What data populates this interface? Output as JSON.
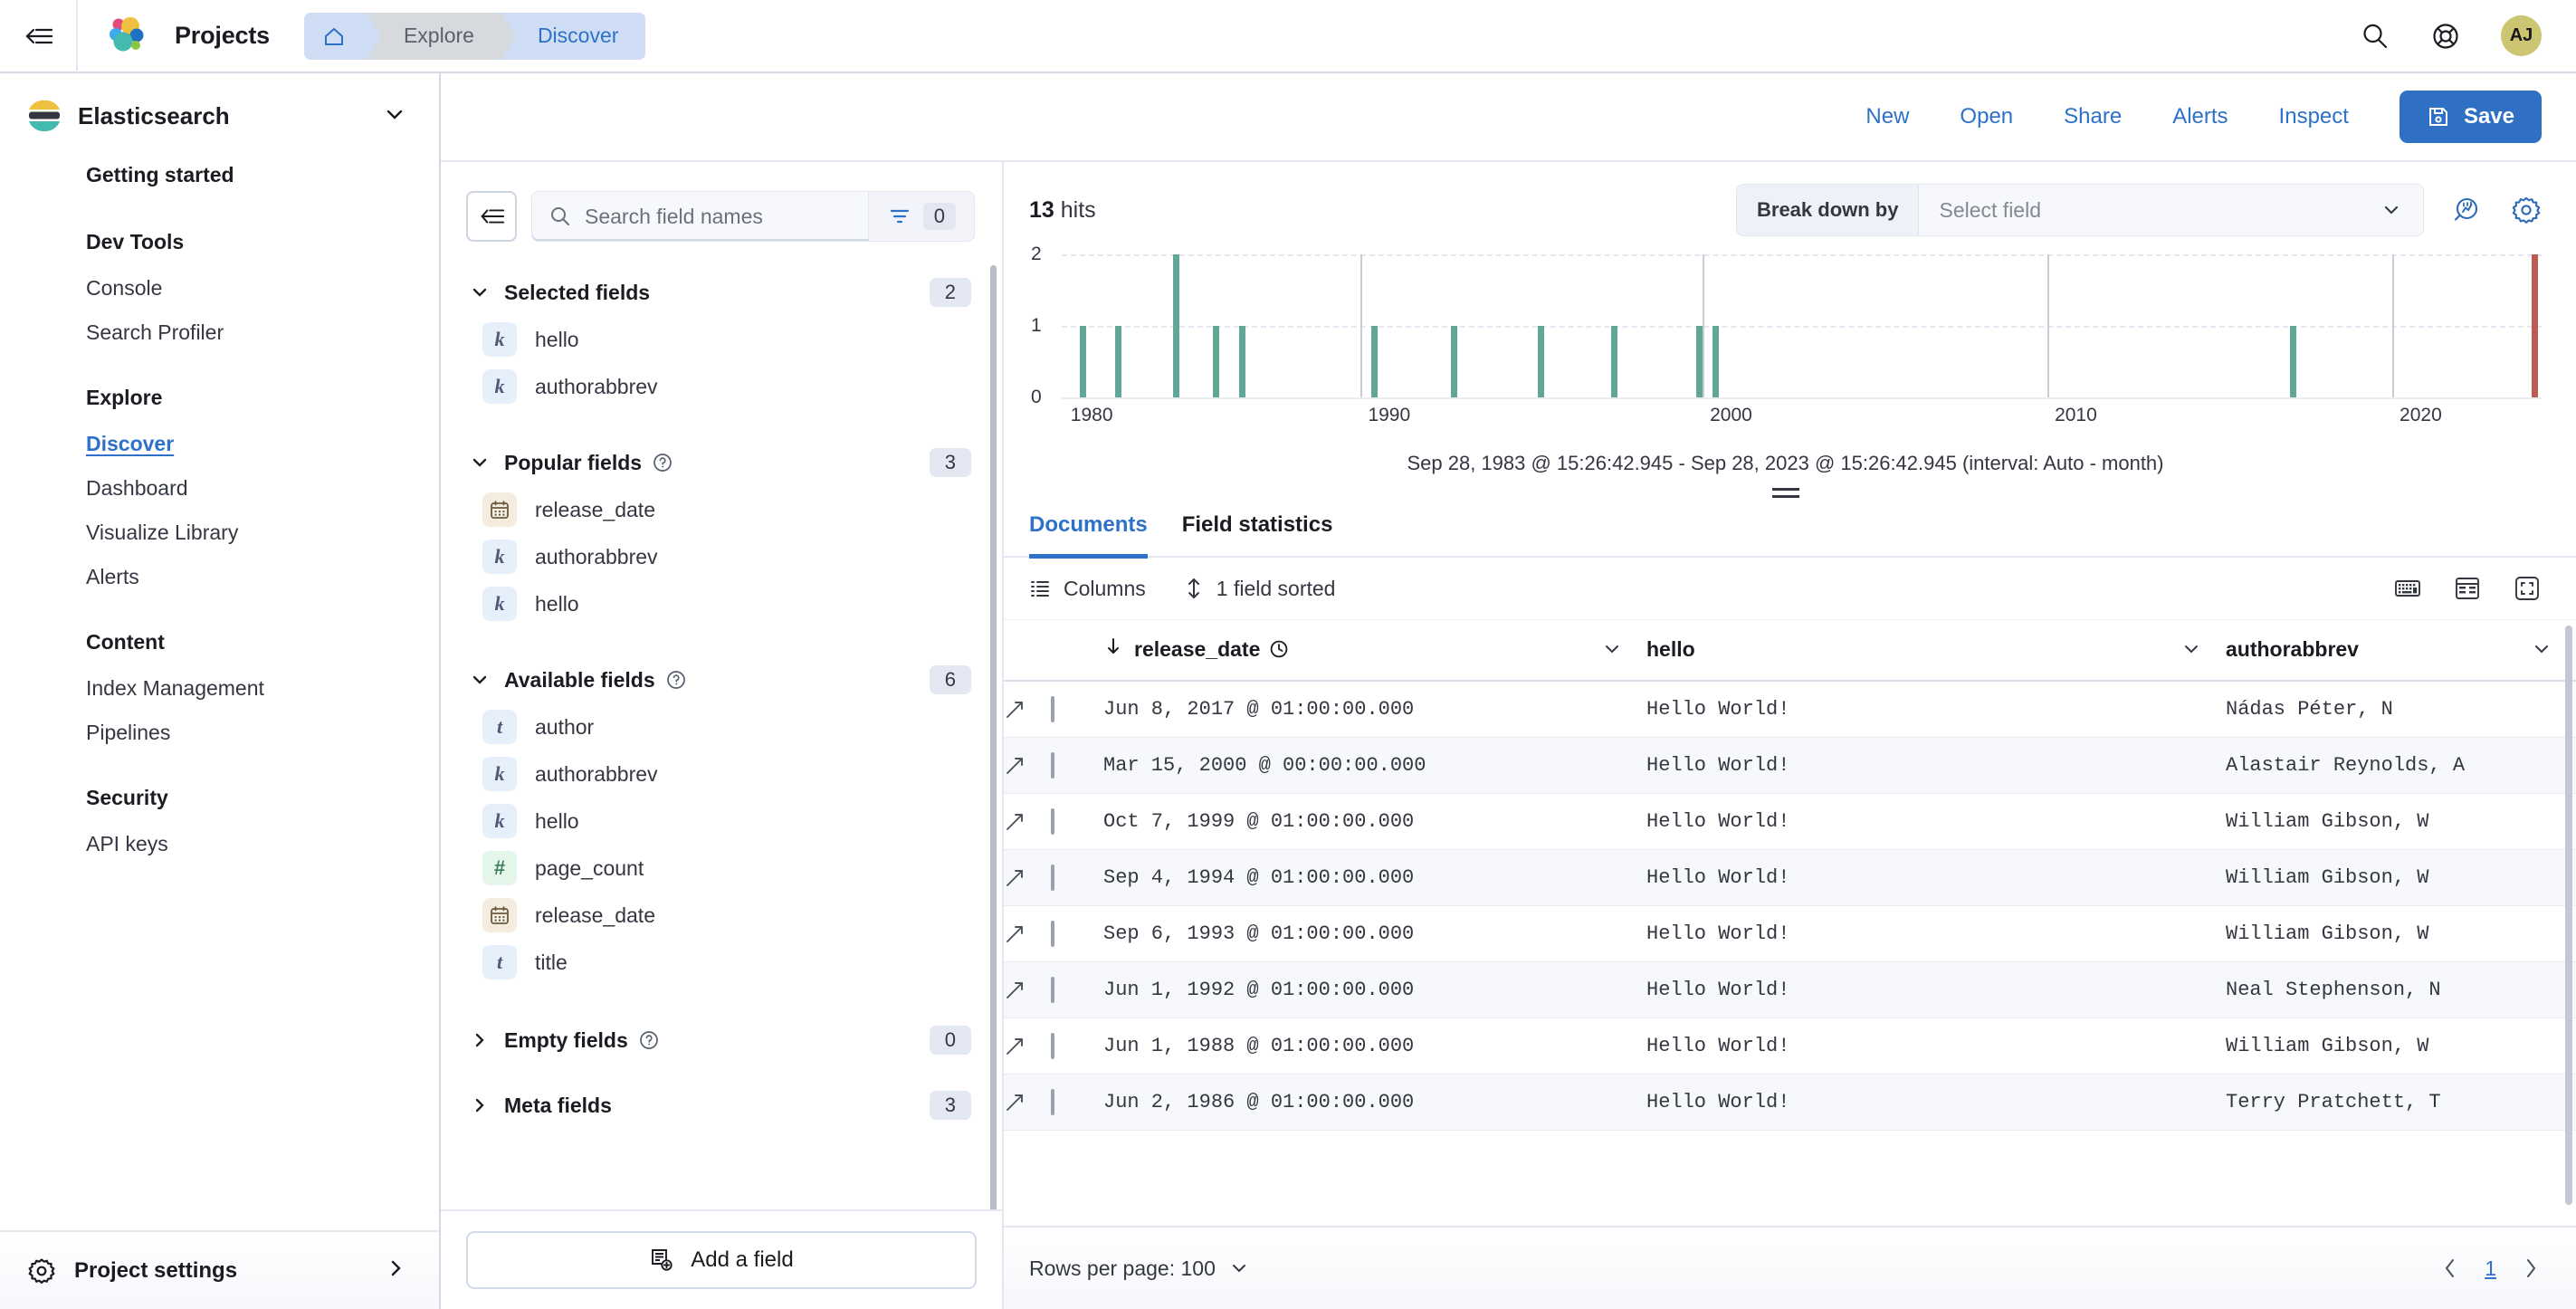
{
  "chrome": {
    "collapse_icon": "collapse-nav-icon",
    "logo": "elastic-logo-icon",
    "title": "Projects",
    "breadcrumbs": [
      {
        "label": "",
        "icon": "home-icon",
        "type": "home"
      },
      {
        "label": "Explore",
        "type": "mid"
      },
      {
        "label": "Discover",
        "type": "last"
      }
    ],
    "actions": [
      {
        "name": "search-icon",
        "label": ""
      },
      {
        "name": "help-icon",
        "label": ""
      }
    ],
    "avatar_initials": "AJ",
    "avatar_color": "#ccc673"
  },
  "sidebar": {
    "solution": {
      "name": "Elasticsearch",
      "icon": "elasticsearch-icon",
      "chevron": "chevron-down-icon"
    },
    "groups": [
      {
        "head": "Getting started",
        "items": []
      },
      {
        "head": "Dev Tools",
        "items": [
          "Console",
          "Search Profiler"
        ]
      },
      {
        "head": "Explore",
        "items": [
          "Discover",
          "Dashboard",
          "Visualize Library",
          "Alerts"
        ],
        "active": "Discover"
      },
      {
        "head": "Content",
        "items": [
          "Index Management",
          "Pipelines"
        ]
      },
      {
        "head": "Security",
        "items": [
          "API keys"
        ]
      }
    ],
    "footer": {
      "label": "Project settings",
      "icon": "gear-icon",
      "chevron": "chevron-right-icon"
    }
  },
  "toolbar": {
    "links": [
      "New",
      "Open",
      "Share",
      "Alerts",
      "Inspect"
    ],
    "save_label": "Save",
    "save_icon": "save-icon",
    "save_color": "#2f70c5"
  },
  "fields_panel": {
    "collapse_icon": "collapse-panel-icon",
    "search": {
      "placeholder": "Search field names",
      "value": ""
    },
    "filter": {
      "icon": "filter-icon",
      "count": "0"
    },
    "sections": [
      {
        "title": "Selected fields",
        "count": "2",
        "expanded": true,
        "help": false,
        "fields": [
          {
            "name": "hello",
            "type": "k"
          },
          {
            "name": "authorabbrev",
            "type": "k"
          }
        ]
      },
      {
        "title": "Popular fields",
        "count": "3",
        "expanded": true,
        "help": true,
        "fields": [
          {
            "name": "release_date",
            "type": "date"
          },
          {
            "name": "authorabbrev",
            "type": "k"
          },
          {
            "name": "hello",
            "type": "k"
          }
        ]
      },
      {
        "title": "Available fields",
        "count": "6",
        "expanded": true,
        "help": true,
        "fields": [
          {
            "name": "author",
            "type": "t"
          },
          {
            "name": "authorabbrev",
            "type": "k"
          },
          {
            "name": "hello",
            "type": "k"
          },
          {
            "name": "page_count",
            "type": "number"
          },
          {
            "name": "release_date",
            "type": "date"
          },
          {
            "name": "title",
            "type": "t"
          }
        ]
      },
      {
        "title": "Empty fields",
        "count": "0",
        "expanded": false,
        "help": true,
        "fields": []
      },
      {
        "title": "Meta fields",
        "count": "3",
        "expanded": false,
        "help": false,
        "fields": []
      }
    ],
    "add_field_label": "Add a field",
    "add_field_icon": "add-field-icon"
  },
  "results": {
    "hits_count": "13",
    "hits_suffix": "hits",
    "breakdown_label": "Break down by",
    "breakdown_value": "Select field",
    "chart_icons": [
      "lens-chart-icon",
      "gear-icon"
    ],
    "chart_caption": "Sep 28, 1983 @ 15:26:42.945 - Sep 28, 2023 @ 15:26:42.945 (interval: Auto - month)",
    "tabs": [
      {
        "label": "Documents",
        "active": true
      },
      {
        "label": "Field statistics",
        "active": false
      }
    ],
    "grid_toolbar": {
      "columns_label": "Columns",
      "columns_icon": "columns-icon",
      "sort_label": "1 field sorted",
      "sort_icon": "sort-icon",
      "right_icons": [
        "keyboard-shortcuts-icon",
        "display-options-icon",
        "fullscreen-icon"
      ]
    },
    "columns": [
      {
        "label": "release_date",
        "sorted": "desc",
        "icon": "clock-icon"
      },
      {
        "label": "hello"
      },
      {
        "label": "authorabbrev"
      }
    ],
    "rows": [
      {
        "release_date": "Jun 8, 2017 @ 01:00:00.000",
        "hello": "Hello World!",
        "authorabbrev": "Nádas Péter, N"
      },
      {
        "release_date": "Mar 15, 2000 @ 00:00:00.000",
        "hello": "Hello World!",
        "authorabbrev": "Alastair Reynolds, A"
      },
      {
        "release_date": "Oct 7, 1999 @ 01:00:00.000",
        "hello": "Hello World!",
        "authorabbrev": "William Gibson, W"
      },
      {
        "release_date": "Sep 4, 1994 @ 01:00:00.000",
        "hello": "Hello World!",
        "authorabbrev": "William Gibson, W"
      },
      {
        "release_date": "Sep 6, 1993 @ 01:00:00.000",
        "hello": "Hello World!",
        "authorabbrev": "William Gibson, W"
      },
      {
        "release_date": "Jun 1, 1992 @ 01:00:00.000",
        "hello": "Hello World!",
        "authorabbrev": "Neal Stephenson, N"
      },
      {
        "release_date": "Jun 1, 1988 @ 01:00:00.000",
        "hello": "Hello World!",
        "authorabbrev": "William Gibson, W"
      },
      {
        "release_date": "Jun 2, 1986 @ 01:00:00.000",
        "hello": "Hello World!",
        "authorabbrev": "Terry Pratchett, T"
      }
    ],
    "pager": {
      "rows_per_page_label": "Rows per page: 100",
      "page": "1",
      "prev_icon": "chevron-left-icon",
      "next_icon": "chevron-right-icon"
    }
  },
  "chart_data": {
    "type": "bar",
    "title": "",
    "xlabel": "",
    "ylabel": "",
    "ylim": [
      0,
      2
    ],
    "yticks": [
      "0",
      "1",
      "2"
    ],
    "xticks": [
      "1980",
      "1990",
      "2000",
      "2010",
      "2020"
    ],
    "grid": true,
    "legend": null,
    "interval": "Auto - month",
    "time_range_start": "Sep 28, 1983 @ 15:26:42.945",
    "time_range_end": "Sep 28, 2023 @ 15:26:42.945",
    "bar_color": "#62a795",
    "now_bar_color": "#bd5a52",
    "x": [
      1979.6,
      1980.6,
      1982.0,
      1983.0,
      1983.6,
      1987.0,
      1992.4,
      1994.0,
      1995.4,
      1999.7,
      2000.1,
      2017.4,
      2023.4
    ],
    "values": [
      1,
      1,
      2,
      1,
      1,
      1,
      1,
      1,
      1,
      1,
      1,
      1,
      2
    ],
    "categories": [
      "1979",
      "1980",
      "1982",
      "1983",
      "1984",
      "1987",
      "1992",
      "1994",
      "1995",
      "1999",
      "2000",
      "2017",
      "2023"
    ]
  }
}
